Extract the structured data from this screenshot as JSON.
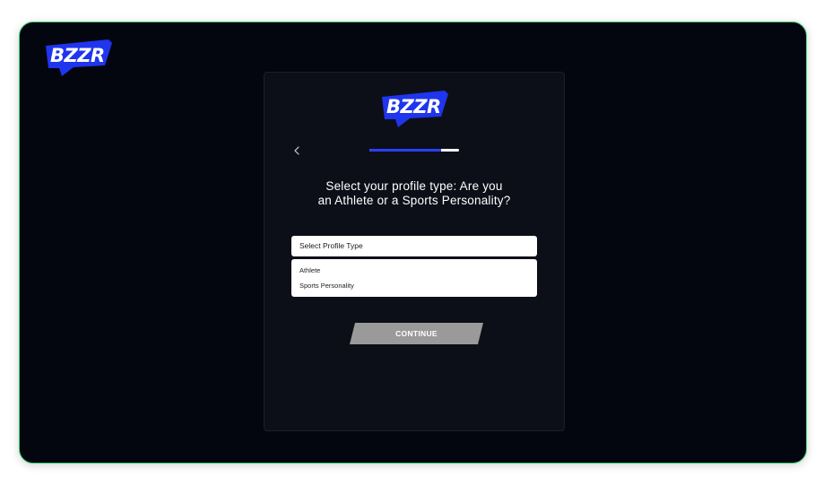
{
  "brand": {
    "logo_text": "BZZR",
    "colors": {
      "logo_blue": "#1f35ee",
      "background": "#04060f",
      "card": "#0d0f18",
      "frame_border": "#3fd17a",
      "progress_fill": "#2b3ff5",
      "progress_track": "#ffffff",
      "button_disabled": "#9a9a9a"
    }
  },
  "step": {
    "back_icon": "chevron-left-icon",
    "progress_fraction": 0.8
  },
  "question": {
    "line1": "Select your profile type: Are you",
    "line2": "an Athlete or a Sports Personality?"
  },
  "profile_select": {
    "placeholder": "Select Profile Type",
    "options": [
      {
        "label": "Athlete"
      },
      {
        "label": "Sports Personality"
      }
    ]
  },
  "continue_button": {
    "label": "CONTINUE",
    "state": "disabled"
  }
}
